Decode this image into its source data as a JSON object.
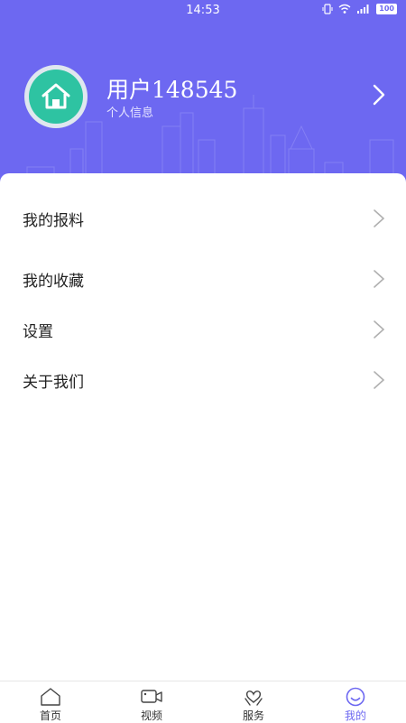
{
  "status_bar": {
    "time": "14:53",
    "battery": "100"
  },
  "profile": {
    "username": "用户148545",
    "subtitle": "个人信息"
  },
  "menu": [
    {
      "label": "我的报料"
    },
    {
      "label": "我的收藏"
    },
    {
      "label": "设置"
    },
    {
      "label": "关于我们"
    }
  ],
  "tabs": [
    {
      "label": "首页",
      "icon": "home-icon"
    },
    {
      "label": "视频",
      "icon": "video-icon"
    },
    {
      "label": "服务",
      "icon": "heart-hands-icon"
    },
    {
      "label": "我的",
      "icon": "smiley-icon",
      "active": true
    }
  ],
  "colors": {
    "accent": "#6d68f1",
    "avatar_green": "#2ec3a2"
  }
}
